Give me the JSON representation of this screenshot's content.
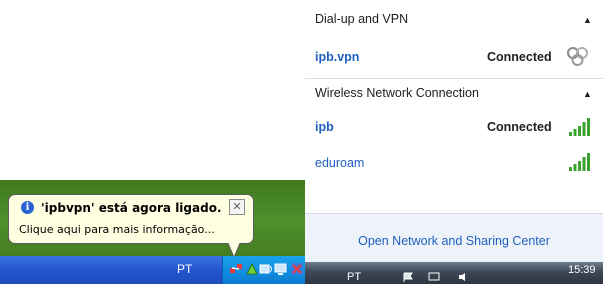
{
  "xp": {
    "balloon": {
      "icon": "info-icon",
      "title": "'ipbvpn' está agora ligado.",
      "close_glyph": "✕",
      "text": "Clique aqui para mais informação..."
    },
    "taskbar": {
      "language": "PT"
    }
  },
  "flyout": {
    "dialup_header": "Dial-up and VPN",
    "vpn": {
      "name": "ipb.vpn",
      "status": "Connected",
      "icon": "vpn-connection-icon"
    },
    "wireless_header": "Wireless Network Connection",
    "wifi": [
      {
        "name": "ipb",
        "status": "Connected",
        "icon": "wifi-signal-icon"
      },
      {
        "name": "eduroam",
        "status": "",
        "icon": "wifi-signal-icon"
      }
    ],
    "footer_link": "Open Network and Sharing Center"
  },
  "win7_taskbar": {
    "language": "PT",
    "clock": "15:39"
  },
  "colors": {
    "link": "#1f5fbf",
    "balloon_bg": "#ffffe1",
    "xp_taskbar": "#2456d1",
    "footer_bg": "#eef3fa"
  }
}
